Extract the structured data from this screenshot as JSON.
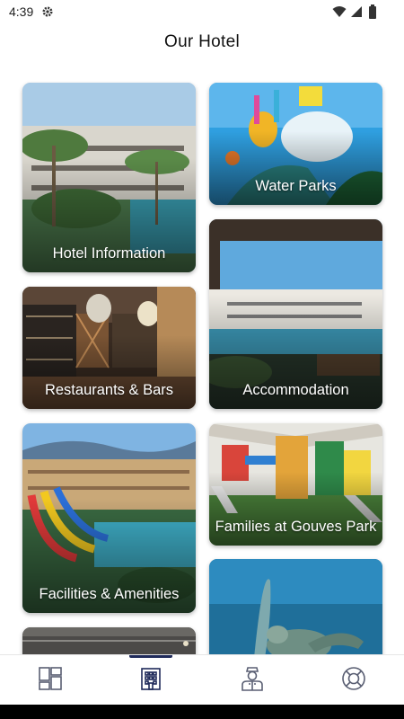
{
  "status": {
    "time": "4:39",
    "icons": [
      "gear-icon",
      "wifi-icon",
      "cell-signal-icon",
      "battery-icon"
    ]
  },
  "header": {
    "title": "Our Hotel"
  },
  "cards": [
    {
      "id": "hotel-information",
      "label": "Hotel Information"
    },
    {
      "id": "water-parks",
      "label": "Water Parks"
    },
    {
      "id": "restaurants-bars",
      "label": "Restaurants & Bars"
    },
    {
      "id": "accommodation",
      "label": "Accommodation"
    },
    {
      "id": "facilities-amenities",
      "label": "Facilities & Amenities"
    },
    {
      "id": "families-gouves-park",
      "label": "Families at Gouves Park"
    },
    {
      "id": "partial-bottom-left",
      "label": ""
    },
    {
      "id": "partial-bottom-right",
      "label": ""
    }
  ],
  "bottom_nav": {
    "items": [
      {
        "icon": "dashboard-icon",
        "active": false
      },
      {
        "icon": "hotel-building-icon",
        "active": true
      },
      {
        "icon": "concierge-icon",
        "active": false
      },
      {
        "icon": "lifebuoy-icon",
        "active": false
      }
    ],
    "active_color": "#1f2a5a",
    "icon_color": "#5a5f73"
  }
}
